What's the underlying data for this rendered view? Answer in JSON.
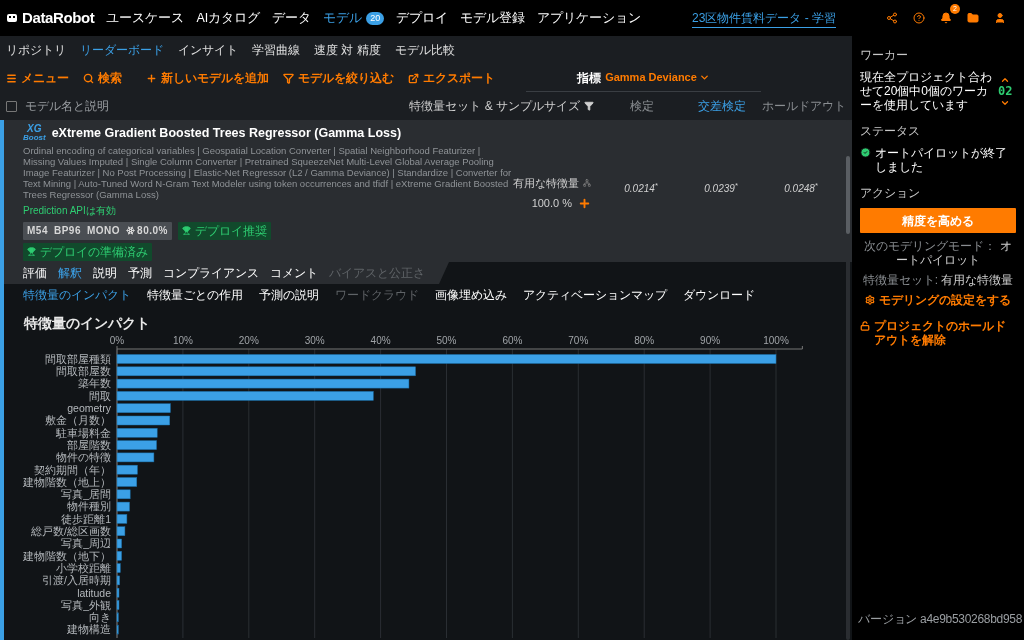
{
  "nav": {
    "logo": "DataRobot",
    "items": [
      {
        "label": "ユースケース",
        "selected": false
      },
      {
        "label": "AIカタログ",
        "selected": false
      },
      {
        "label": "データ",
        "selected": false
      },
      {
        "label": "モデル",
        "selected": true,
        "badge": "20"
      },
      {
        "label": "デプロイ",
        "selected": false
      },
      {
        "label": "モデル登録",
        "selected": false
      },
      {
        "label": "アプリケーション",
        "selected": false
      }
    ],
    "project": "23区物件賃料データ - 学習",
    "notification_count": "2"
  },
  "subnav": [
    {
      "label": "リポジトリ",
      "selected": false
    },
    {
      "label": "リーダーボード",
      "selected": true
    },
    {
      "label": "インサイト",
      "selected": false
    },
    {
      "label": "学習曲線",
      "selected": false
    },
    {
      "label": "速度 対 精度",
      "selected": false
    },
    {
      "label": "モデル比較",
      "selected": false
    }
  ],
  "toolbar": {
    "actions": [
      "メニュー",
      "検索",
      "新しいモデルを追加",
      "モデルを絞り込む",
      "エクスポート"
    ],
    "metric_label": "指標",
    "metric_value": "Gamma Deviance"
  },
  "columns": {
    "select_all": {
      "checked": false
    },
    "model": "モデル名と説明",
    "features": "特徴量セット & サンプルサイズ",
    "scores": [
      {
        "label": "検定",
        "selected": false
      },
      {
        "label": "交差検定",
        "selected": true
      },
      {
        "label": "ホールドアウト",
        "selected": false
      }
    ]
  },
  "model": {
    "logo": [
      "XG",
      "Boost"
    ],
    "title": "eXtreme Gradient Boosted Trees Regressor (Gamma Loss)",
    "description": "Ordinal encoding of categorical variables | Geospatial Location Converter | Spatial Neighborhood Featurizer | Missing Values Imputed | Single Column Converter | Pretrained SqueezeNet Multi-Level Global Average Pooling Image Featurizer | No Post Processing | Elastic-Net Regressor (L2 / Gamma Deviance) | Standardize | Converter for Text Mining | Auto-Tuned Word N-Gram Text Modeler using token occurrences and tfidf | eXtreme Gradient Boosted Trees Regressor (Gamma Loss)",
    "api_status": "Prediction APIは有効",
    "tags": [
      {
        "kind": "info",
        "parts": [
          "M54",
          "BP96",
          "MONO"
        ],
        "frozen": "80.0%"
      },
      {
        "kind": "award",
        "parts": [
          "デプロイ推奨"
        ]
      },
      {
        "kind": "award",
        "parts": [
          "デプロイの準備済み"
        ]
      }
    ],
    "feature_set": "有用な特徴量",
    "sample_size": "100.0 %",
    "scores": [
      "0.0214$^{*}$",
      "0.0239$^{*}$",
      "0.0248$^{*}$"
    ]
  },
  "tabs": [
    {
      "label": "評価",
      "selected": false,
      "disabled": false
    },
    {
      "label": "解釈",
      "selected": true,
      "disabled": false
    },
    {
      "label": "説明",
      "selected": false,
      "disabled": false
    },
    {
      "label": "予測",
      "selected": false,
      "disabled": false
    },
    {
      "label": "コンプライアンス",
      "selected": false,
      "disabled": false
    },
    {
      "label": "コメント",
      "selected": false,
      "disabled": false
    },
    {
      "label": "バイアスと公正さ",
      "selected": false,
      "disabled": true
    }
  ],
  "subtabs": [
    {
      "label": "特徴量のインパクト",
      "selected": true,
      "disabled": false
    },
    {
      "label": "特徴量ごとの作用",
      "selected": false,
      "disabled": false
    },
    {
      "label": "予測の説明",
      "selected": false,
      "disabled": false
    },
    {
      "label": "ワードクラウド",
      "selected": false,
      "disabled": true
    },
    {
      "label": "画像埋め込み",
      "selected": false,
      "disabled": false
    },
    {
      "label": "アクティベーションマップ",
      "selected": false,
      "disabled": false
    },
    {
      "label": "ダウンロード",
      "selected": false,
      "disabled": false
    }
  ],
  "impact": {
    "title": "特徴量のインパクト",
    "chart_data": {
      "type": "bar",
      "orientation": "horizontal",
      "grid": true,
      "categories": [
        "間取部屋種類",
        "間取部屋数",
        "築年数",
        "間取",
        "geometry",
        "敷金（月数）",
        "駐車場料金",
        "部屋階数",
        "物件の特徴",
        "契約期間（年）",
        "建物階数（地上）",
        "写真_居間",
        "物件種別",
        "徒歩距離1",
        "総戸数/総区画数",
        "写真_周辺",
        "建物階数（地下）",
        "小学校距離",
        "引渡/入居時期",
        "latitude",
        "写真_外観",
        "向き",
        "建物構造"
      ],
      "values": [
        100,
        45.3,
        44.3,
        38.9,
        8.1,
        8.0,
        6.1,
        6.0,
        5.6,
        3.1,
        3.0,
        2.0,
        1.9,
        1.5,
        1.2,
        0.7,
        0.7,
        0.5,
        0.4,
        0.3,
        0.3,
        0.2,
        0.2
      ],
      "xlim": [
        0,
        104
      ],
      "xticks": [
        {
          "value": 0,
          "label": "0%"
        },
        {
          "value": 10,
          "label": "10%"
        },
        {
          "value": 20,
          "label": "20%"
        },
        {
          "value": 30,
          "label": "30%"
        },
        {
          "value": 40,
          "label": "40%"
        },
        {
          "value": 50,
          "label": "50%"
        },
        {
          "value": 60,
          "label": "60%"
        },
        {
          "value": 70,
          "label": "70%"
        },
        {
          "value": 80,
          "label": "80%"
        },
        {
          "value": 90,
          "label": "90%"
        },
        {
          "value": 100,
          "label": "100%"
        }
      ]
    }
  },
  "sidebar": {
    "worker_heading": "ワーカー",
    "worker_text": "現在全プロジェクト合わせて20個中0個のワーカーを使用しています",
    "worker_count": "02",
    "status_heading": "ステータス",
    "status_text": "オートパイロットが終了しました",
    "action_heading": "アクション",
    "primary_button": "精度を高める",
    "next_mode_label": "次のモデリングモード：",
    "next_mode_value": "オートパイロット",
    "feature_set_label": "特徴量セット:",
    "feature_set_value": "有用な特徴量",
    "links": [
      "モデリングの設定をする",
      "プロジェクトのホールドアウトを解除"
    ],
    "version": "バージョン a4e9b530268bd958"
  }
}
